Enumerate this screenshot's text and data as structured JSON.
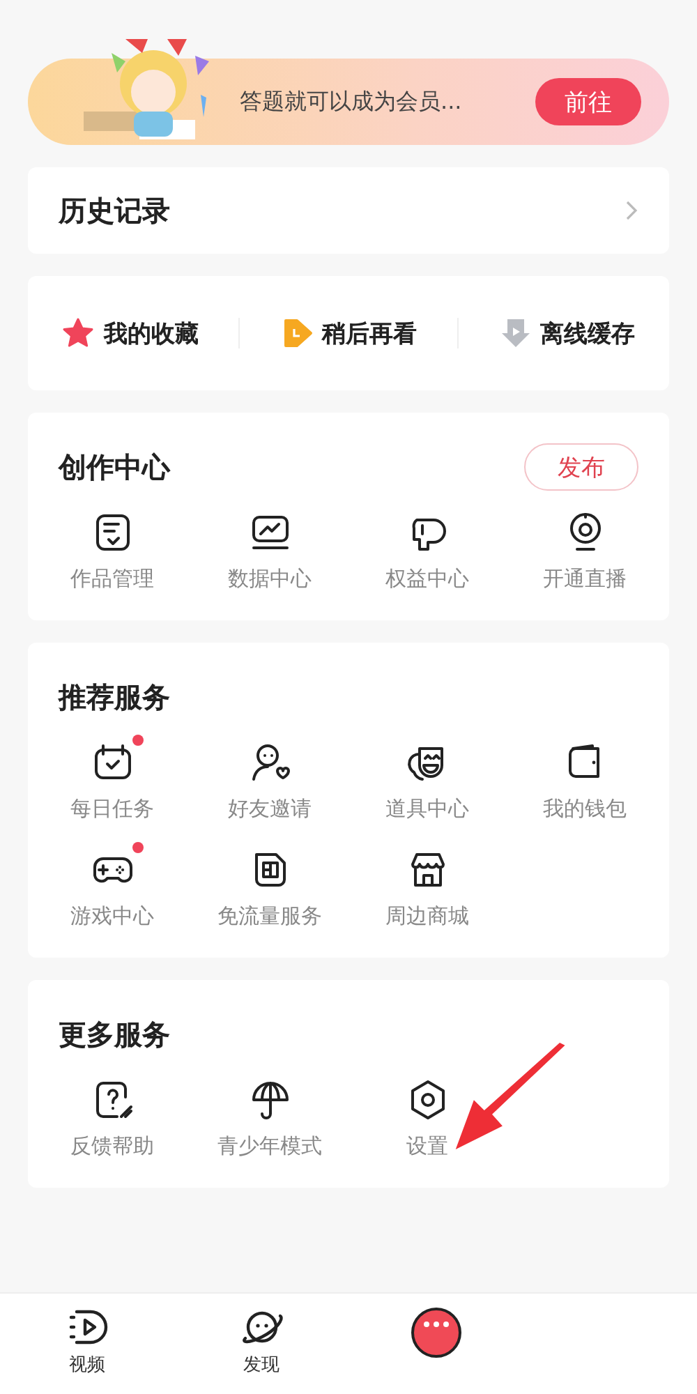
{
  "banner": {
    "text": "答题就可以成为会员...",
    "button": "前往"
  },
  "history": {
    "title": "历史记录"
  },
  "shortcuts": [
    {
      "label": "我的收藏"
    },
    {
      "label": "稍后再看"
    },
    {
      "label": "离线缓存"
    }
  ],
  "sections": [
    {
      "title": "创作中心",
      "action": "发布",
      "items": [
        {
          "label": "作品管理",
          "dot": false
        },
        {
          "label": "数据中心",
          "dot": false
        },
        {
          "label": "权益中心",
          "dot": false
        },
        {
          "label": "开通直播",
          "dot": false
        }
      ]
    },
    {
      "title": "推荐服务",
      "items": [
        {
          "label": "每日任务",
          "dot": true
        },
        {
          "label": "好友邀请",
          "dot": false
        },
        {
          "label": "道具中心",
          "dot": false
        },
        {
          "label": "我的钱包",
          "dot": false
        },
        {
          "label": "游戏中心",
          "dot": true
        },
        {
          "label": "免流量服务",
          "dot": false
        },
        {
          "label": "周边商城",
          "dot": false
        }
      ]
    },
    {
      "title": "更多服务",
      "items": [
        {
          "label": "反馈帮助",
          "dot": false
        },
        {
          "label": "青少年模式",
          "dot": false
        },
        {
          "label": "设置",
          "dot": false
        }
      ]
    }
  ],
  "nav": [
    {
      "label": "视频"
    },
    {
      "label": "发现"
    }
  ]
}
